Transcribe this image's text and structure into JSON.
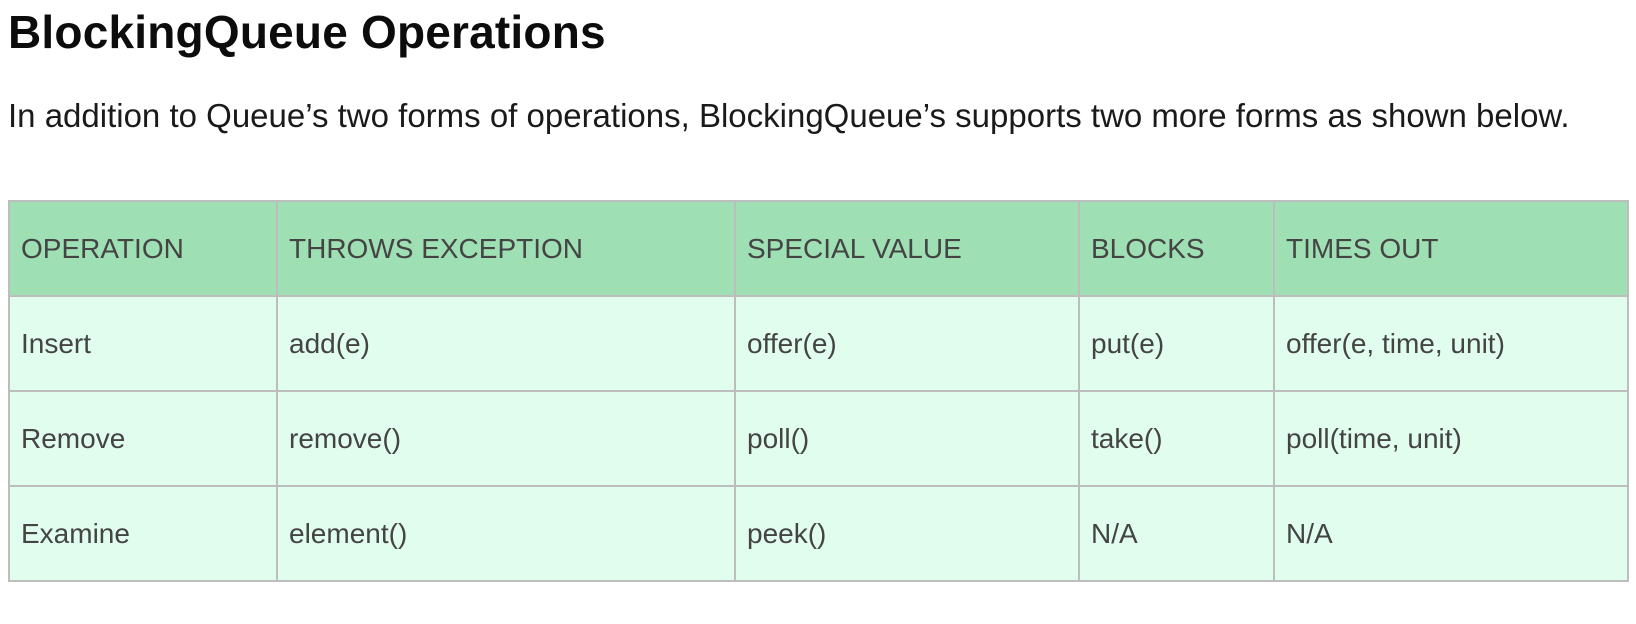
{
  "heading": {
    "title": "BlockingQueue Operations",
    "intro": "In addition to Queue’s two forms of operations, BlockingQueue’s supports two more forms as shown below."
  },
  "table": {
    "headers": [
      "OPERATION",
      "THROWS EXCEPTION",
      "SPECIAL VALUE",
      "BLOCKS",
      "TIMES OUT"
    ],
    "rows": [
      [
        "Insert",
        "add(e)",
        "offer(e)",
        "put(e)",
        "offer(e, time, unit)"
      ],
      [
        "Remove",
        "remove()",
        "poll()",
        "take()",
        "poll(time, unit)"
      ],
      [
        "Examine",
        "element()",
        "peek()",
        "N/A",
        "N/A"
      ]
    ]
  },
  "colors": {
    "header_bg": "#9edfb3",
    "cell_bg": "#e0fdee",
    "border": "#bdbdbd",
    "cell_text": "#444444"
  }
}
